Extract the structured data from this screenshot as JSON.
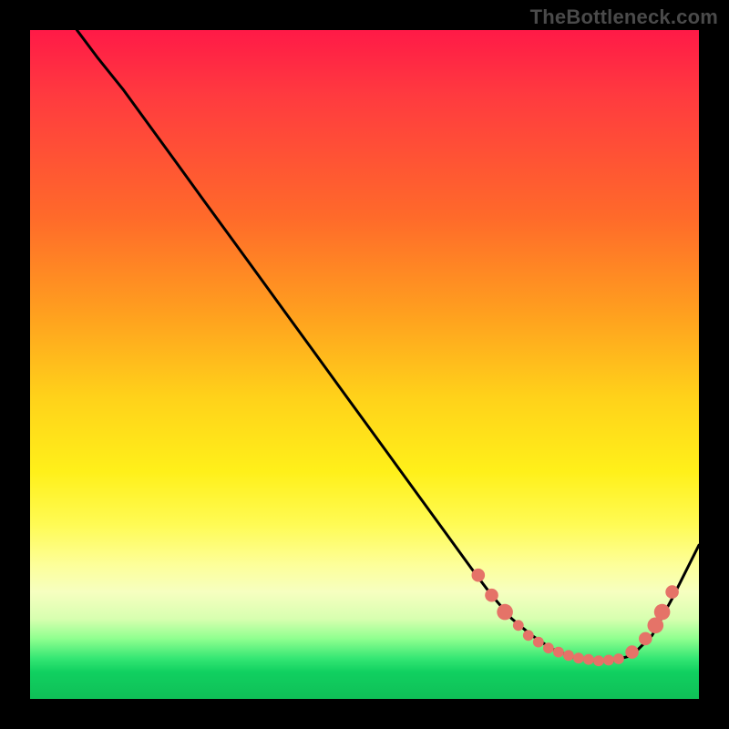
{
  "watermark": "TheBottleneck.com",
  "colors": {
    "background": "#000000",
    "curve": "#000000",
    "dots": "#e57368"
  },
  "chart_data": {
    "type": "line",
    "title": "",
    "xlabel": "",
    "ylabel": "",
    "xlim": [
      0,
      100
    ],
    "ylim": [
      0,
      100
    ],
    "grid": false,
    "legend": false,
    "series": [
      {
        "name": "curve",
        "x": [
          7,
          10,
          14,
          18,
          22,
          26,
          30,
          34,
          38,
          42,
          46,
          50,
          54,
          58,
          62,
          66,
          69,
          72,
          75,
          78,
          81,
          84,
          87,
          90,
          93,
          96,
          100
        ],
        "y": [
          100,
          96,
          91,
          85.5,
          80,
          74.5,
          69,
          63.5,
          58,
          52.5,
          47,
          41.5,
          36,
          30.5,
          25,
          19.5,
          15.5,
          12,
          9.5,
          7.5,
          6.3,
          5.7,
          5.7,
          6.5,
          9.5,
          15,
          23
        ]
      }
    ],
    "markers": [
      {
        "x": 67,
        "y": 18.5,
        "r": 1.0
      },
      {
        "x": 69,
        "y": 15.5,
        "r": 1.0
      },
      {
        "x": 71,
        "y": 13.0,
        "r": 1.2
      },
      {
        "x": 73,
        "y": 11.0,
        "r": 0.8
      },
      {
        "x": 74.5,
        "y": 9.5,
        "r": 0.8
      },
      {
        "x": 76,
        "y": 8.5,
        "r": 0.8
      },
      {
        "x": 77.5,
        "y": 7.6,
        "r": 0.8
      },
      {
        "x": 79,
        "y": 7.0,
        "r": 0.8
      },
      {
        "x": 80.5,
        "y": 6.5,
        "r": 0.8
      },
      {
        "x": 82,
        "y": 6.1,
        "r": 0.8
      },
      {
        "x": 83.5,
        "y": 5.9,
        "r": 0.8
      },
      {
        "x": 85,
        "y": 5.7,
        "r": 0.8
      },
      {
        "x": 86.5,
        "y": 5.8,
        "r": 0.8
      },
      {
        "x": 88,
        "y": 6.0,
        "r": 0.8
      },
      {
        "x": 90,
        "y": 7.0,
        "r": 1.0
      },
      {
        "x": 92,
        "y": 9.0,
        "r": 1.0
      },
      {
        "x": 93.5,
        "y": 11.0,
        "r": 1.2
      },
      {
        "x": 94.5,
        "y": 13.0,
        "r": 1.2
      },
      {
        "x": 96,
        "y": 16.0,
        "r": 1.0
      }
    ]
  }
}
